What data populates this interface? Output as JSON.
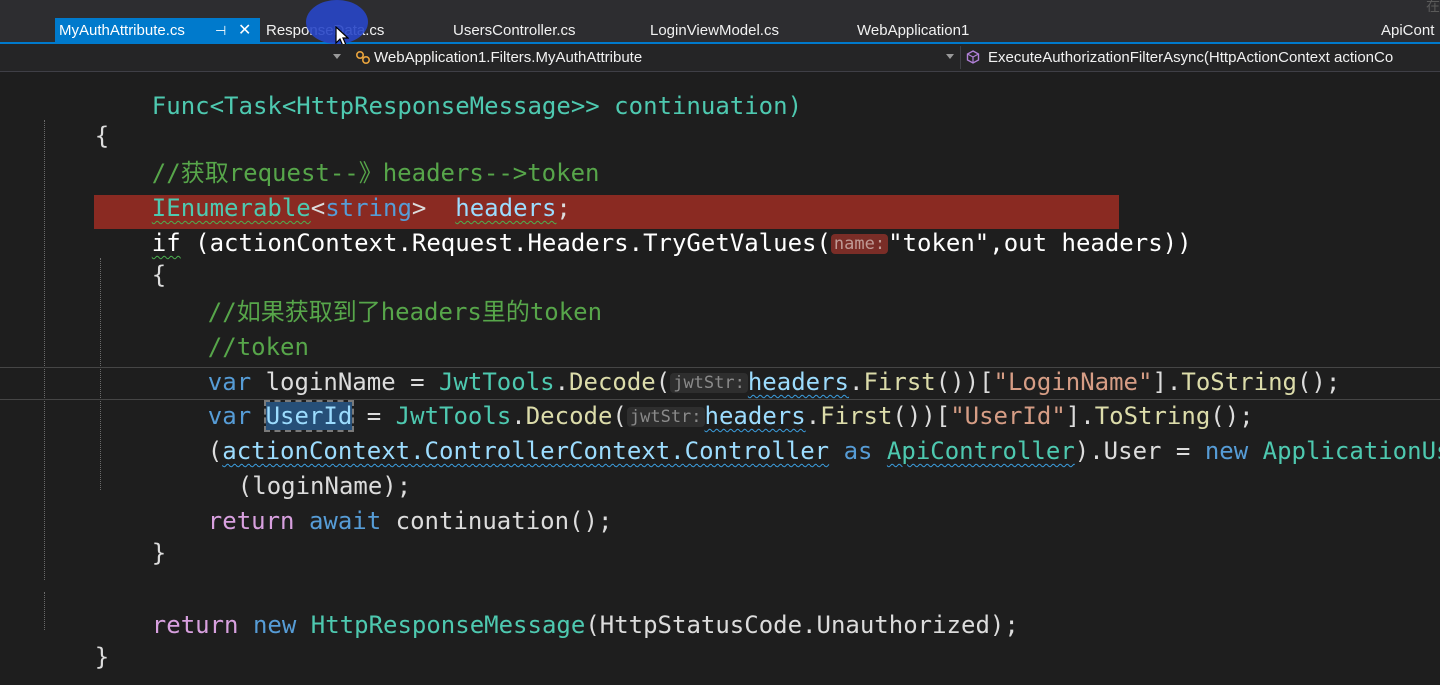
{
  "tabs": [
    {
      "label": "MyAuthAttribute.cs",
      "active": true
    },
    {
      "label": "ResponseData.cs",
      "active": false
    },
    {
      "label": "UsersController.cs",
      "active": false
    },
    {
      "label": "LoginViewModel.cs",
      "active": false
    },
    {
      "label": "WebApplication1",
      "active": false
    },
    {
      "label": "ApiCont",
      "active": false
    }
  ],
  "tab_icons": {
    "pin": "pin-icon",
    "close": "close-icon"
  },
  "corner_watermark": "在",
  "navbar": {
    "class_path": "WebApplication1.Filters.MyAuthAttribute",
    "member": "ExecuteAuthorizationFilterAsync(HttpActionContext actionCo"
  },
  "code": {
    "l0": {
      "a": "Func<Task<HttpResponseMessage>> continuation)"
    },
    "l1": {
      "a": "{"
    },
    "l2": {
      "a": "//获取request--》headers-->token"
    },
    "l3": {
      "a": "IEnumerable",
      "b": "<",
      "c": "string",
      "d": ">  ",
      "e": "headers",
      "f": ";"
    },
    "l4": {
      "a": "if",
      "b": " (actionContext.Request.Headers.TryGetValues(",
      "hint": "name:",
      "c": "\"token\"",
      "d": ",out headers))"
    },
    "l5": {
      "a": "{"
    },
    "l6": {
      "a": "//如果获取到了headers里的token"
    },
    "l7": {
      "a": "//token"
    },
    "l8": {
      "a": "var",
      "b": " loginName = ",
      "c": "JwtTools",
      "d": ".",
      "e": "Decode",
      "f": "(",
      "hint": "jwtStr:",
      "g": "headers",
      "h": ".",
      "i": "First",
      "j": "())[",
      "k": "\"LoginName\"",
      "l": "].",
      "m": "ToString",
      "n": "();"
    },
    "l9": {
      "a": "var",
      "b": " ",
      "c": "UserId",
      "d": " = ",
      "e": "JwtTools",
      "f": ".",
      "g": "Decode",
      "h": "(",
      "hint": "jwtStr:",
      "i": "headers",
      "j": ".",
      "k": "First",
      "l": "())[",
      "m": "\"UserId\"",
      "n": "].",
      "o": "ToString",
      "p": "();"
    },
    "l10": {
      "a": "(",
      "b": "actionContext.ControllerContext.Controller",
      "c": " as ",
      "d": "ApiController",
      "e": ").User = ",
      "f": "new",
      "g": " ",
      "h": "ApplicationUser"
    },
    "l11": {
      "a": "(loginName);"
    },
    "l12": {
      "a": "return",
      "b": " ",
      "c": "await",
      "d": " continuation();"
    },
    "l13": {
      "a": "}"
    },
    "l14": {
      "a": "return",
      "b": " ",
      "c": "new",
      "d": " ",
      "e": "HttpResponseMessage",
      "f": "(HttpStatusCode.Unauthorized);"
    },
    "l15": {
      "a": "}"
    }
  }
}
